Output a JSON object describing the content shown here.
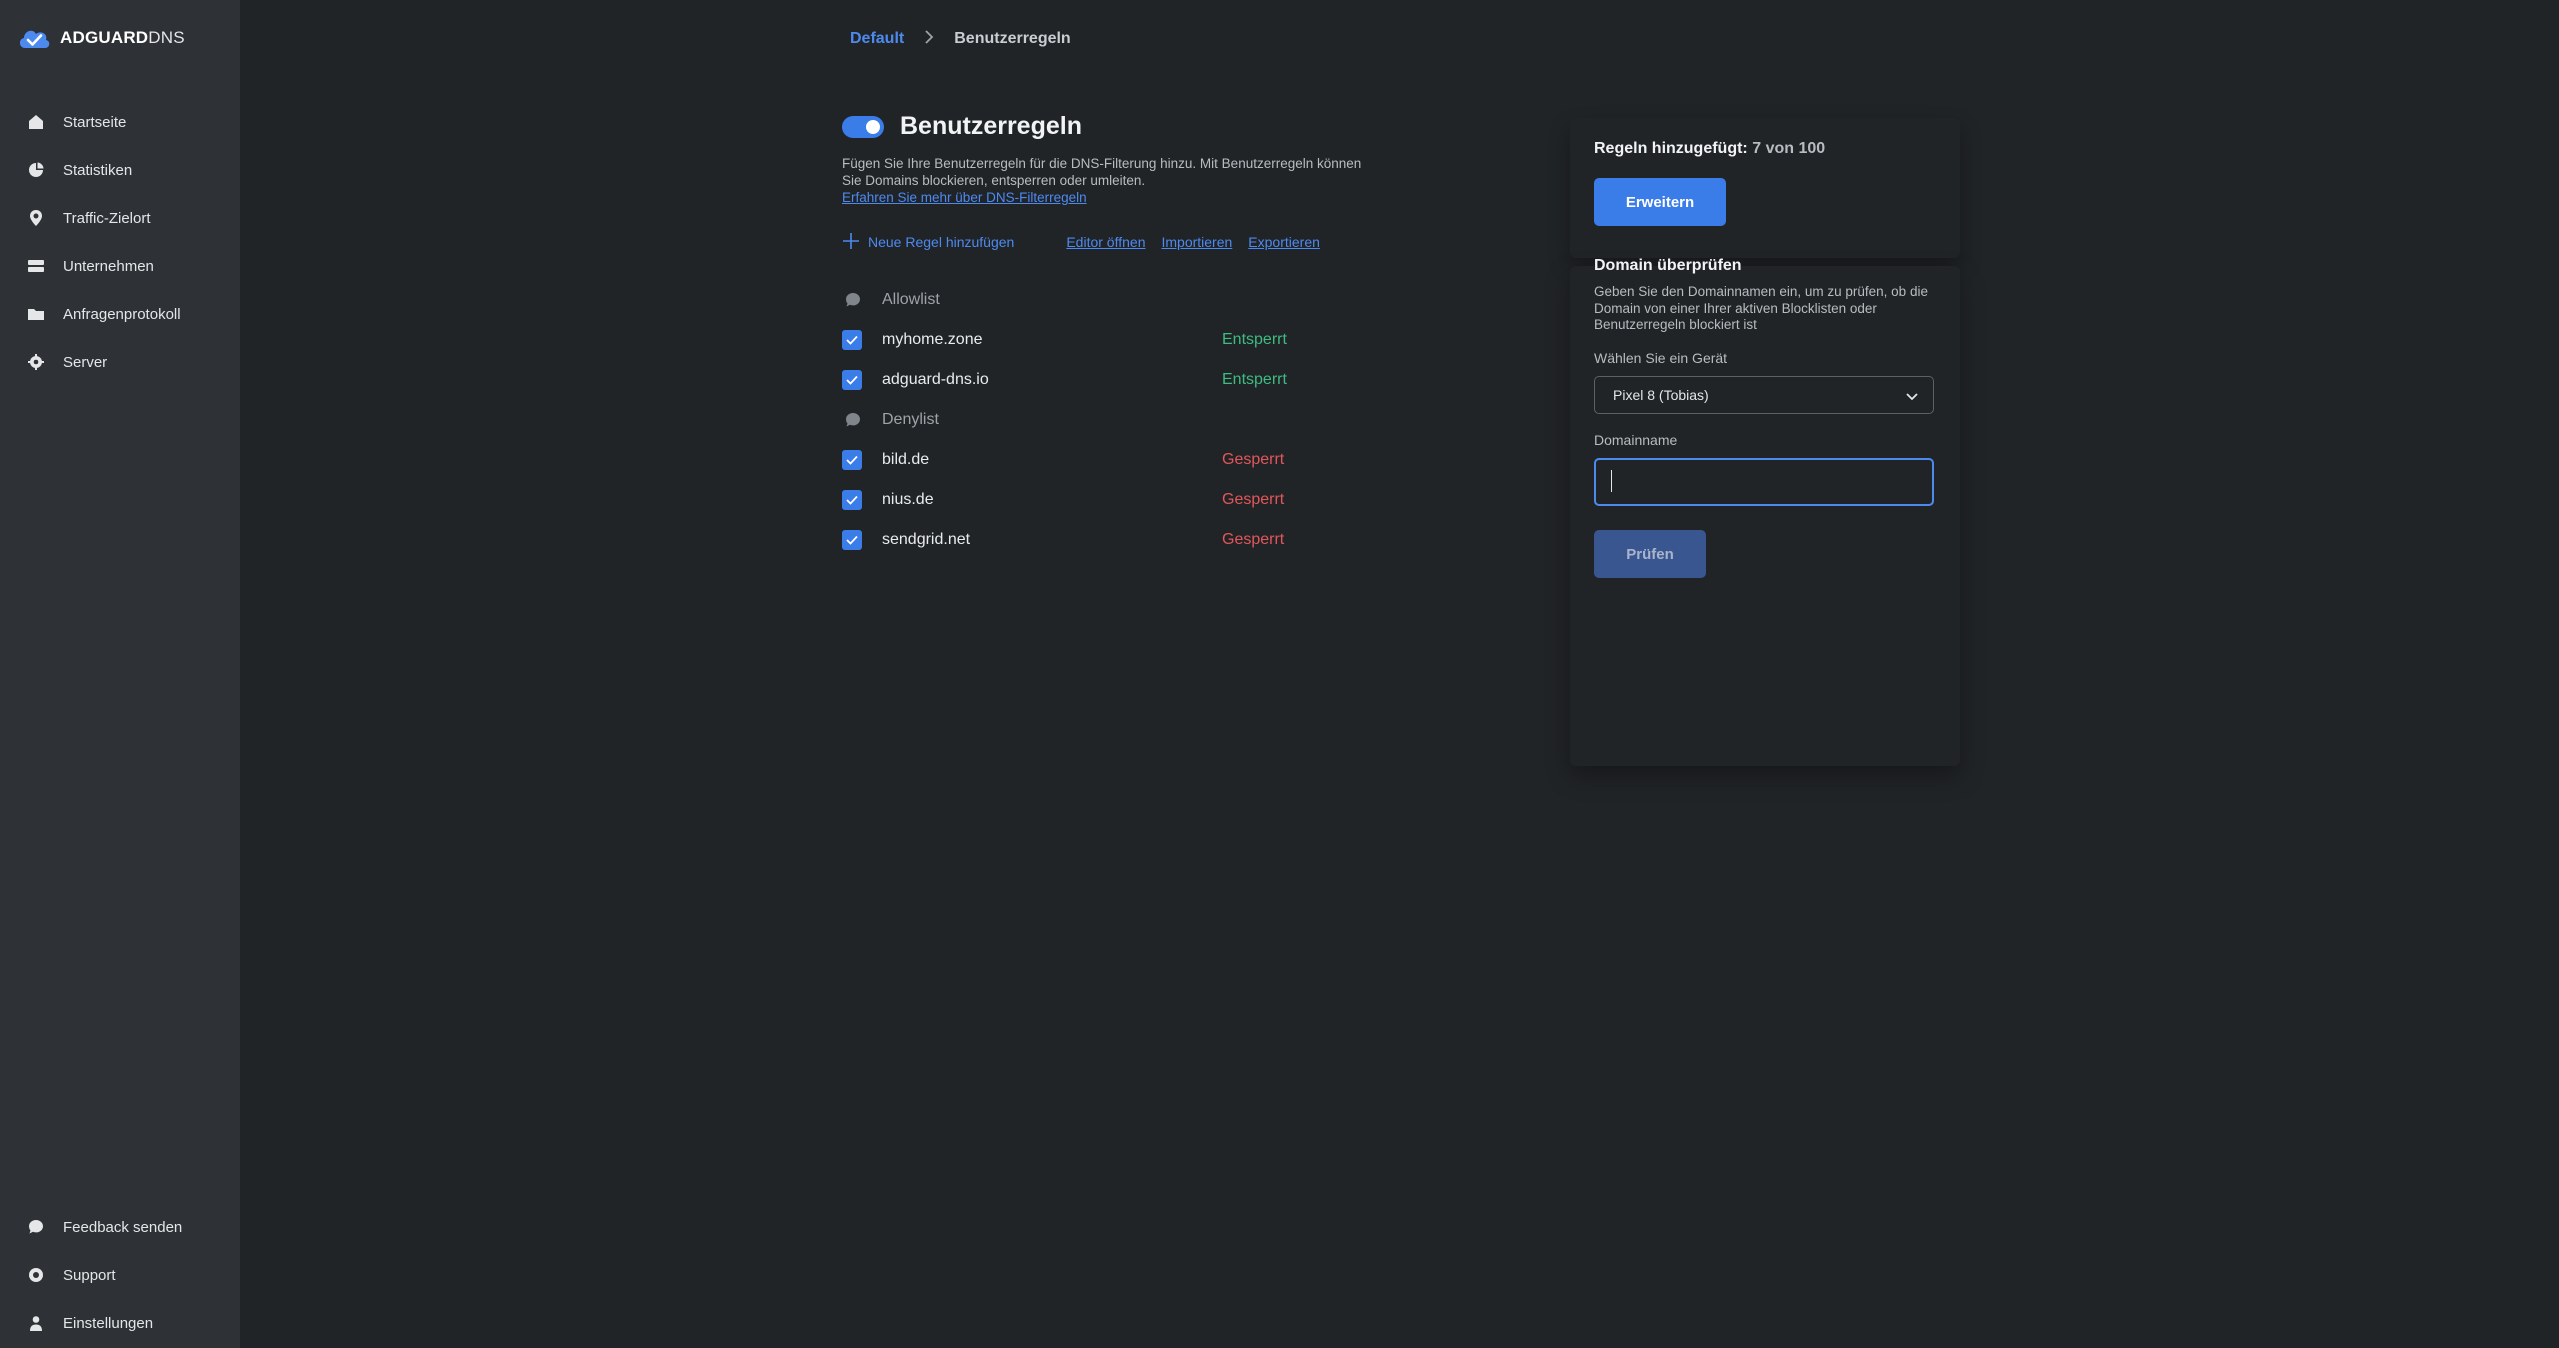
{
  "brand": {
    "name_bold": "ADGUARD",
    "name_regular": "DNS"
  },
  "sidebar": {
    "items": [
      {
        "label": "Startseite",
        "icon": "home-icon"
      },
      {
        "label": "Statistiken",
        "icon": "pie-chart-icon"
      },
      {
        "label": "Traffic-Zielort",
        "icon": "location-icon"
      },
      {
        "label": "Unternehmen",
        "icon": "server-stack-icon"
      },
      {
        "label": "Anfragenprotokoll",
        "icon": "folder-icon"
      },
      {
        "label": "Server",
        "icon": "gear-icon"
      }
    ],
    "footer": [
      {
        "label": "Feedback senden",
        "icon": "chat-bubble-icon"
      },
      {
        "label": "Support",
        "icon": "lifebuoy-icon"
      },
      {
        "label": "Einstellungen",
        "icon": "user-icon"
      }
    ]
  },
  "breadcrumb": {
    "parent": "Default",
    "current": "Benutzerregeln"
  },
  "main": {
    "title": "Benutzerregeln",
    "toggle_on": true,
    "description": "Fügen Sie Ihre Benutzerregeln für die DNS-Filterung hinzu. Mit Benutzerregeln können Sie Domains blockieren, entsperren oder umleiten.",
    "learn_more": "Erfahren Sie mehr über DNS-Filterregeln",
    "actions": {
      "add_rule": "Neue Regel hinzufügen",
      "open_editor": "Editor öffnen",
      "import": "Importieren",
      "export": "Exportieren"
    },
    "rules": [
      {
        "type": "comment",
        "text": "Allowlist"
      },
      {
        "type": "rule",
        "text": "myhome.zone",
        "status": "Entsperrt",
        "checked": true
      },
      {
        "type": "rule",
        "text": "adguard-dns.io",
        "status": "Entsperrt",
        "checked": true
      },
      {
        "type": "comment",
        "text": "Denylist"
      },
      {
        "type": "rule",
        "text": "bild.de",
        "status": "Gesperrt",
        "checked": true
      },
      {
        "type": "rule",
        "text": "nius.de",
        "status": "Gesperrt",
        "checked": true
      },
      {
        "type": "rule",
        "text": "sendgrid.net",
        "status": "Gesperrt",
        "checked": true
      }
    ]
  },
  "panel": {
    "rules_added_label": "Regeln hinzugefügt:",
    "rules_added_count": "7 von 100",
    "expand_button": "Erweitern",
    "check_title": "Domain überprüfen",
    "check_description": "Geben Sie den Domainnamen ein, um zu prüfen, ob die Domain von einer Ihrer aktiven Blocklisten oder Benutzerregeln blockiert ist",
    "device_label": "Wählen Sie ein Gerät",
    "device_value": "Pixel 8 (Tobias)",
    "domain_label": "Domainname",
    "domain_value": "",
    "check_button": "Prüfen"
  },
  "colors": {
    "accent": "#3a7ce8",
    "link": "#4d8af0",
    "unblocked": "#3dbc83",
    "blocked": "#e2565a",
    "sidebar_bg": "#2e3236",
    "page_bg": "#212427"
  }
}
